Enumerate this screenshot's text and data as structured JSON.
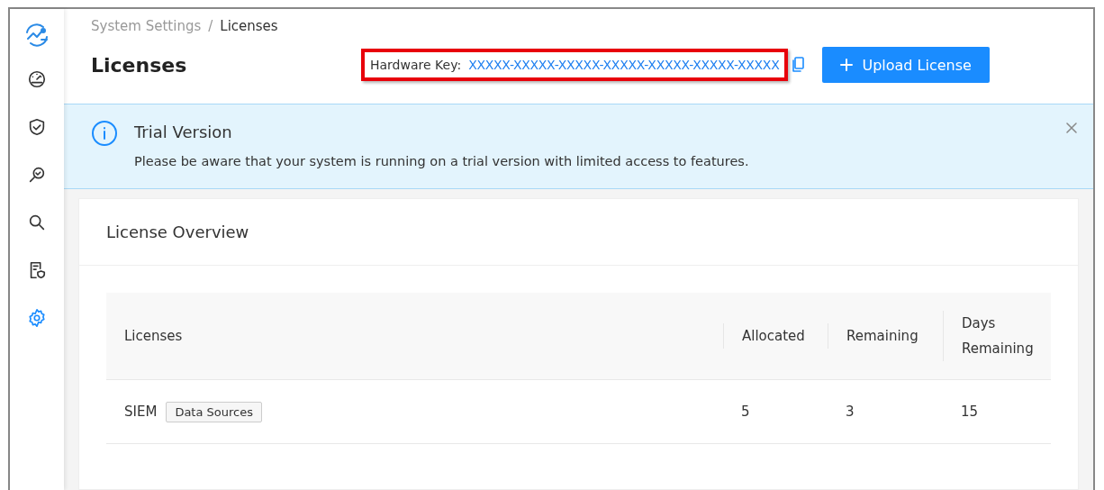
{
  "sidebar": {
    "items": [
      {
        "kind": "gauge",
        "selected": false
      },
      {
        "kind": "shield",
        "selected": false
      },
      {
        "kind": "inspect",
        "selected": false
      },
      {
        "kind": "search",
        "selected": false
      },
      {
        "kind": "report",
        "selected": false
      },
      {
        "kind": "settings",
        "selected": true
      }
    ]
  },
  "breadcrumb": {
    "items": [
      "System Settings",
      "Licenses"
    ],
    "separator": "/"
  },
  "page_title": "Licenses",
  "hardware_key": {
    "label": "Hardware Key:",
    "value": "XXXXX-XXXXX-XXXXX-XXXXX-XXXXX-XXXXX-XXXXX",
    "highlighted": true
  },
  "upload_button": {
    "label": "Upload License"
  },
  "alert": {
    "title": "Trial Version",
    "message": "Please be aware that your system is running on a trial version with limited access to features."
  },
  "card": {
    "title": "License Overview",
    "table": {
      "columns": [
        "Licenses",
        "Allocated",
        "Remaining",
        "Days Remaining"
      ],
      "rows": [
        {
          "name": "SIEM",
          "tag": "Data Sources",
          "allocated": "5",
          "remaining": "3",
          "days_remaining": "15"
        }
      ]
    }
  }
}
